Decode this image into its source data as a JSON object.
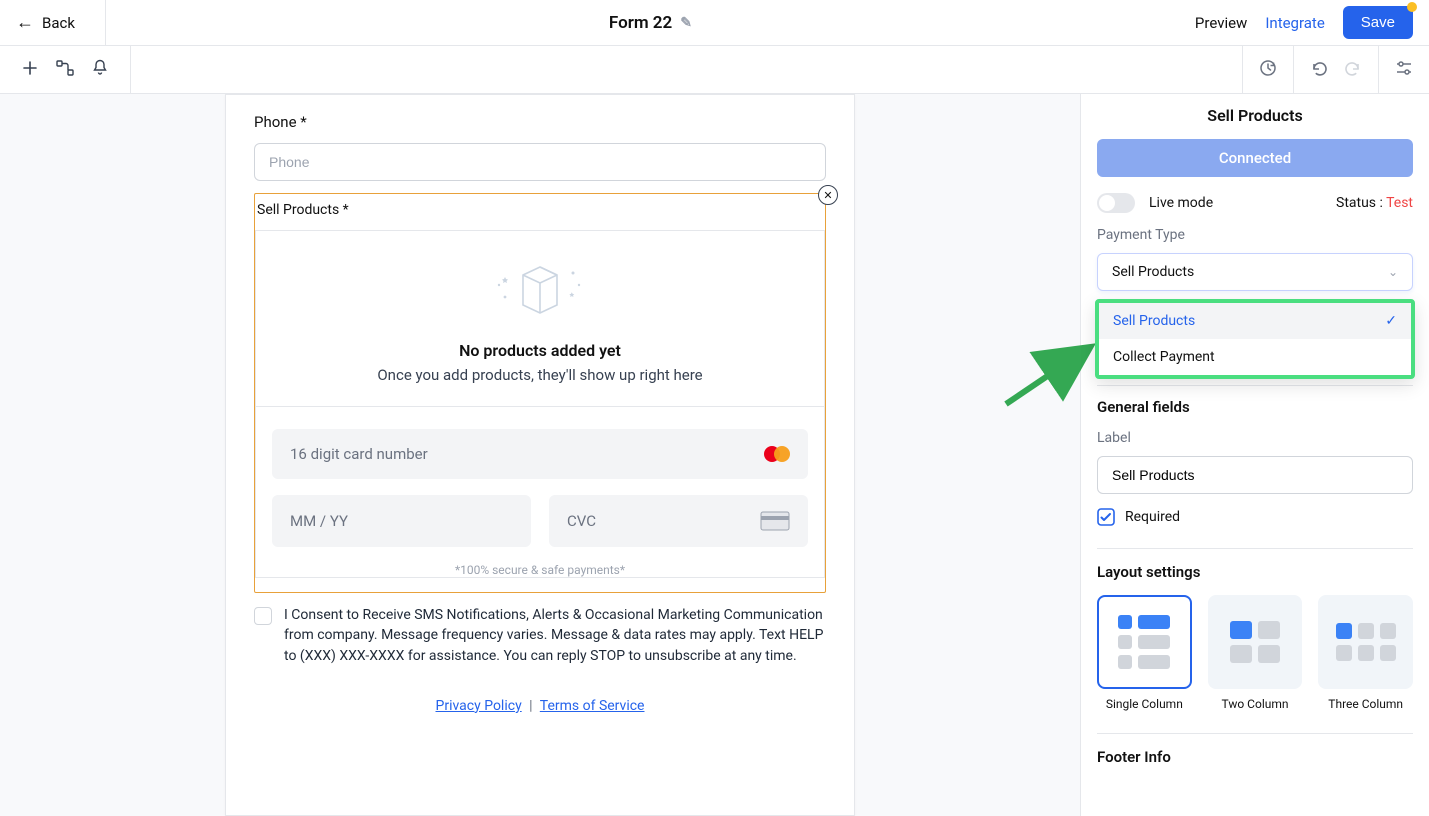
{
  "topbar": {
    "back": "Back",
    "title": "Form 22",
    "preview": "Preview",
    "integrate": "Integrate",
    "save": "Save"
  },
  "phone": {
    "label": "Phone *",
    "placeholder": "Phone"
  },
  "sell": {
    "label": "Sell Products *",
    "emptyTitle": "No products added yet",
    "emptySub": "Once you add products, they'll show up right here",
    "cardNumber": "16 digit card number",
    "exp": "MM / YY",
    "cvc": "CVC",
    "secure": "*100% secure & safe payments*"
  },
  "consent": "I Consent to Receive SMS Notifications, Alerts & Occasional Marketing Communication from company. Message frequency varies. Message & data rates may apply. Text HELP to (XXX) XXX-XXXX for assistance. You can reply STOP to unsubscribe at any time.",
  "footerLinks": {
    "privacy": "Privacy Policy",
    "terms": "Terms of Service"
  },
  "panel": {
    "title": "Sell Products",
    "connected": "Connected",
    "liveMode": "Live mode",
    "statusLabel": "Status : ",
    "statusValue": "Test",
    "paymentType": "Payment Type",
    "selectValue": "Sell Products",
    "optSell": "Sell Products",
    "optCollect": "Collect Payment",
    "generalFields": "General fields",
    "labelLabel": "Label",
    "labelValue": "Sell Products",
    "required": "Required",
    "layoutSettings": "Layout settings",
    "layout1": "Single Column",
    "layout2": "Two Column",
    "layout3": "Three Column",
    "footerInfo": "Footer Info"
  }
}
